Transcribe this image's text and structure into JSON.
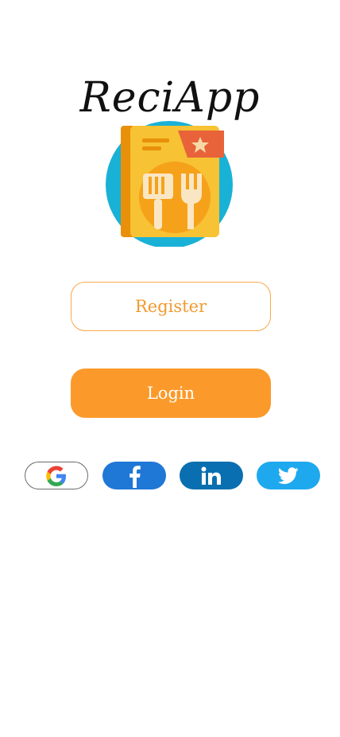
{
  "app": {
    "title": "ReciApp"
  },
  "buttons": {
    "register_label": "Register",
    "login_label": "Login"
  },
  "social": [
    {
      "icon": "google-icon",
      "color": "#ffffff"
    },
    {
      "icon": "facebook-icon",
      "color": "#1f77d6"
    },
    {
      "icon": "linkedin-icon",
      "color": "#0a6fb0"
    },
    {
      "icon": "twitter-icon",
      "color": "#1ea8ee"
    }
  ],
  "colors": {
    "accent": "#fb9a2a",
    "register_text": "#f19a2e"
  }
}
